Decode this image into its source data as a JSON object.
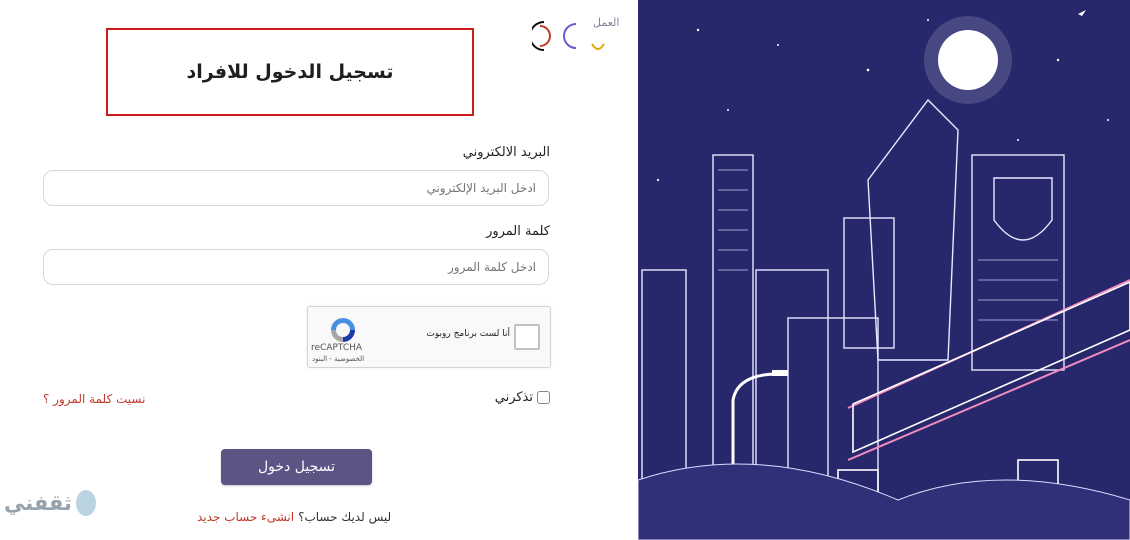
{
  "brand": {
    "logo_text": "العمل"
  },
  "login": {
    "title": "تسجيل الدخول للافراد",
    "email_label": "البريد الالكتروني",
    "email_placeholder": "ادخل البريد الإلكتروني",
    "password_label": "كلمة المرور",
    "password_placeholder": "ادخل كلمة المرور",
    "recaptcha_text": "أنا لست برنامج روبوت",
    "recaptcha_brand": "reCAPTCHA",
    "recaptcha_links": "الخصوصية - البنود",
    "remember_label": "تذكرني",
    "forgot_link": "نسيت كلمة المرور ؟",
    "submit_label": "تسجيل دخول",
    "no_account_text": "ليس لديك حساب؟",
    "create_account_link": "انشىء حساب جديد"
  },
  "watermark": {
    "text": "ثقفني"
  },
  "colors": {
    "accent_button": "#5b5485",
    "highlight_border": "#d01a1a",
    "illustration_bg": "#27286b",
    "link": "#c0392b"
  }
}
